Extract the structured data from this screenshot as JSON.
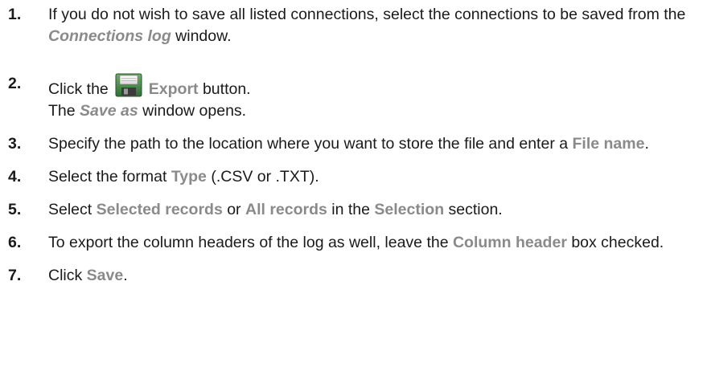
{
  "steps": [
    {
      "number": "1.",
      "parts": {
        "a": "If you do not wish to save all listed connections, select the connections to be saved from the ",
        "b": "Connections log",
        "c": " window."
      }
    },
    {
      "number": "2.",
      "parts": {
        "a": "Click the",
        "b": "Export",
        "c": " button.",
        "d": "The ",
        "e": "Save as",
        "f": " window opens."
      },
      "icon": "floppy-disk-save-icon"
    },
    {
      "number": "3.",
      "parts": {
        "a": "Specify the path to the location where you want to store the file and enter a ",
        "b": "File name",
        "c": "."
      }
    },
    {
      "number": "4.",
      "parts": {
        "a": "Select the format ",
        "b": "Type",
        "c": " (.CSV or .TXT)."
      }
    },
    {
      "number": "5.",
      "parts": {
        "a": "Select ",
        "b": "Selected records",
        "c": " or ",
        "d": "All records",
        "e": " in the ",
        "f": "Selection",
        "g": " section."
      }
    },
    {
      "number": "6.",
      "parts": {
        "a": "To export the column headers of the log as well, leave the ",
        "b": "Column header",
        "c": " box checked."
      }
    },
    {
      "number": "7.",
      "parts": {
        "a": "Click ",
        "b": "Save",
        "c": "."
      }
    }
  ],
  "colors": {
    "ui_term": "#8a8a8a",
    "text": "#1a1a1a"
  }
}
